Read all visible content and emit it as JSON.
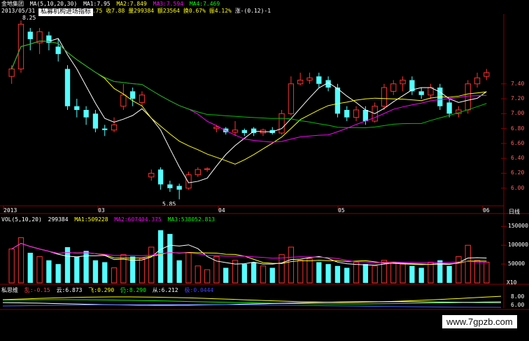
{
  "header": {
    "title": "金地集团",
    "ma_label": "MA(5,10,20,30)",
    "ma1": "MA1:7.95",
    "ma2": "MA2:7.849",
    "ma3": "MA3:7.594",
    "ma4": "MA4:7.469",
    "date": "2013/05/31",
    "partial": "7.75",
    "close": "收7.88",
    "volume": "量299384",
    "amount": "额23564",
    "turnover": "换0.67%",
    "amplitude": "振4.12%",
    "change": "涨-(0.12)-1"
  },
  "badge": "私募机构进场指标",
  "top_price_marker": "8.25",
  "low_marker": "5.85",
  "price_axis": [
    "7.40",
    "7.20",
    "7.00",
    "6.80",
    "6.60",
    "6.40",
    "6.20",
    "6.00"
  ],
  "date_axis": [
    "2013",
    "03",
    "04",
    "05",
    "06"
  ],
  "period_label": "日线",
  "volume_panel": {
    "label": "VOL(5,10,20)",
    "value": "299384",
    "ma1": "MA1:509228",
    "ma2": "MA2:607404.375",
    "ma3": "MA3:538052.813",
    "axis": [
      "150000",
      "100000",
      "50000"
    ],
    "scale": "X10"
  },
  "indicator_panel": {
    "label": "私思维",
    "a": "乱:-0.15",
    "b": "云:6.873",
    "c": "飞:0.290",
    "d": "仍:8.290",
    "e": "从:6.212",
    "f": "极:0.0444",
    "axis": [
      "8.00",
      "6.00"
    ]
  },
  "watermark": "www.7gpzb.com",
  "colors": {
    "up": "#ff3030",
    "down": "#54ffff",
    "ma_white": "#ffffff",
    "ma_yellow": "#ffff00",
    "ma_magenta": "#ff00ff",
    "ma_green": "#00c000",
    "axis_red": "#8b0000"
  },
  "chart_data": {
    "type": "candlestick",
    "candles": [
      {
        "o": 7.5,
        "c": 7.6,
        "h": 7.65,
        "l": 7.4,
        "up": true
      },
      {
        "o": 7.6,
        "c": 8.2,
        "h": 8.25,
        "l": 7.55,
        "up": true
      },
      {
        "o": 8.1,
        "c": 8.0,
        "h": 8.15,
        "l": 7.85,
        "up": false
      },
      {
        "o": 7.95,
        "c": 8.1,
        "h": 8.15,
        "l": 7.8,
        "up": true
      },
      {
        "o": 8.05,
        "c": 7.95,
        "h": 8.1,
        "l": 7.85,
        "up": false
      },
      {
        "o": 7.9,
        "c": 7.8,
        "h": 8.0,
        "l": 7.7,
        "up": false
      },
      {
        "o": 7.6,
        "c": 7.1,
        "h": 7.65,
        "l": 7.05,
        "up": false
      },
      {
        "o": 7.1,
        "c": 7.05,
        "h": 7.2,
        "l": 6.95,
        "up": false
      },
      {
        "o": 7.05,
        "c": 6.95,
        "h": 7.1,
        "l": 6.85,
        "up": false
      },
      {
        "o": 7.0,
        "c": 6.8,
        "h": 7.05,
        "l": 6.75,
        "up": false
      },
      {
        "o": 6.8,
        "c": 6.78,
        "h": 6.85,
        "l": 6.7,
        "up": false
      },
      {
        "o": 6.78,
        "c": 6.85,
        "h": 6.95,
        "l": 6.75,
        "up": true
      },
      {
        "o": 7.1,
        "c": 7.25,
        "h": 7.4,
        "l": 7.05,
        "up": true
      },
      {
        "o": 7.3,
        "c": 7.2,
        "h": 7.35,
        "l": 7.1,
        "up": false
      },
      {
        "o": 7.15,
        "c": 7.25,
        "h": 7.3,
        "l": 7.1,
        "up": true
      },
      {
        "o": 6.2,
        "c": 6.15,
        "h": 6.25,
        "l": 6.1,
        "up": true
      },
      {
        "o": 6.25,
        "c": 6.05,
        "h": 6.28,
        "l": 5.98,
        "up": false
      },
      {
        "o": 6.05,
        "c": 6.0,
        "h": 6.1,
        "l": 5.95,
        "up": false
      },
      {
        "o": 6.03,
        "c": 5.98,
        "h": 6.06,
        "l": 5.85,
        "up": false
      },
      {
        "o": 6.0,
        "c": 6.18,
        "h": 6.22,
        "l": 5.98,
        "up": true
      },
      {
        "o": 6.18,
        "c": 6.25,
        "h": 6.28,
        "l": 6.15,
        "up": true
      },
      {
        "o": 6.25,
        "c": 6.26,
        "h": 6.28,
        "l": 6.22,
        "up": true
      },
      {
        "o": 6.8,
        "c": 6.82,
        "h": 6.85,
        "l": 6.75,
        "up": true
      },
      {
        "o": 6.8,
        "c": 6.75,
        "h": 6.82,
        "l": 6.72,
        "up": false
      },
      {
        "o": 6.75,
        "c": 6.78,
        "h": 6.9,
        "l": 6.7,
        "up": true
      },
      {
        "o": 6.78,
        "c": 6.74,
        "h": 6.8,
        "l": 6.7,
        "up": false
      },
      {
        "o": 6.8,
        "c": 6.74,
        "h": 6.82,
        "l": 6.7,
        "up": false
      },
      {
        "o": 6.74,
        "c": 6.78,
        "h": 6.8,
        "l": 6.7,
        "up": true
      },
      {
        "o": 6.78,
        "c": 6.74,
        "h": 6.82,
        "l": 6.72,
        "up": false
      },
      {
        "o": 6.74,
        "c": 7.0,
        "h": 7.05,
        "l": 6.72,
        "up": true
      },
      {
        "o": 7.0,
        "c": 7.4,
        "h": 7.5,
        "l": 6.98,
        "up": true
      },
      {
        "o": 7.4,
        "c": 7.45,
        "h": 7.55,
        "l": 7.38,
        "up": true
      },
      {
        "o": 7.45,
        "c": 7.48,
        "h": 7.55,
        "l": 7.4,
        "up": true
      },
      {
        "o": 7.5,
        "c": 7.4,
        "h": 7.55,
        "l": 7.35,
        "up": false
      },
      {
        "o": 7.45,
        "c": 7.35,
        "h": 7.5,
        "l": 7.3,
        "up": false
      },
      {
        "o": 7.35,
        "c": 7.0,
        "h": 7.4,
        "l": 6.95,
        "up": false
      },
      {
        "o": 7.05,
        "c": 6.95,
        "h": 7.1,
        "l": 6.9,
        "up": false
      },
      {
        "o": 6.95,
        "c": 7.05,
        "h": 7.1,
        "l": 6.9,
        "up": true
      },
      {
        "o": 7.05,
        "c": 6.9,
        "h": 7.1,
        "l": 6.85,
        "up": false
      },
      {
        "o": 6.9,
        "c": 7.1,
        "h": 7.15,
        "l": 6.88,
        "up": true
      },
      {
        "o": 7.1,
        "c": 7.35,
        "h": 7.4,
        "l": 7.05,
        "up": true
      },
      {
        "o": 7.3,
        "c": 7.4,
        "h": 7.45,
        "l": 7.25,
        "up": true
      },
      {
        "o": 7.4,
        "c": 7.45,
        "h": 7.5,
        "l": 7.3,
        "up": true
      },
      {
        "o": 7.45,
        "c": 7.3,
        "h": 7.5,
        "l": 7.25,
        "up": false
      },
      {
        "o": 7.3,
        "c": 7.25,
        "h": 7.35,
        "l": 7.2,
        "up": false
      },
      {
        "o": 7.25,
        "c": 7.35,
        "h": 7.4,
        "l": 7.2,
        "up": true
      },
      {
        "o": 7.35,
        "c": 7.1,
        "h": 7.4,
        "l": 7.05,
        "up": false
      },
      {
        "o": 7.15,
        "c": 7.0,
        "h": 7.2,
        "l": 6.95,
        "up": false
      },
      {
        "o": 7.0,
        "c": 7.05,
        "h": 7.1,
        "l": 6.95,
        "up": true
      },
      {
        "o": 7.05,
        "c": 7.4,
        "h": 7.45,
        "l": 7.0,
        "up": true
      },
      {
        "o": 7.4,
        "c": 7.48,
        "h": 7.55,
        "l": 7.35,
        "up": true
      },
      {
        "o": 7.5,
        "c": 7.55,
        "h": 7.6,
        "l": 7.45,
        "up": true
      }
    ],
    "volume": [
      90,
      120,
      80,
      70,
      60,
      50,
      95,
      70,
      85,
      60,
      55,
      40,
      75,
      70,
      65,
      95,
      140,
      130,
      60,
      80,
      45,
      35,
      70,
      40,
      60,
      50,
      55,
      45,
      40,
      75,
      95,
      60,
      65,
      55,
      50,
      45,
      40,
      55,
      50,
      45,
      60,
      55,
      50,
      45,
      40,
      55,
      60,
      45,
      70,
      100,
      60,
      55
    ],
    "ylim": [
      5.8,
      8.3
    ]
  }
}
